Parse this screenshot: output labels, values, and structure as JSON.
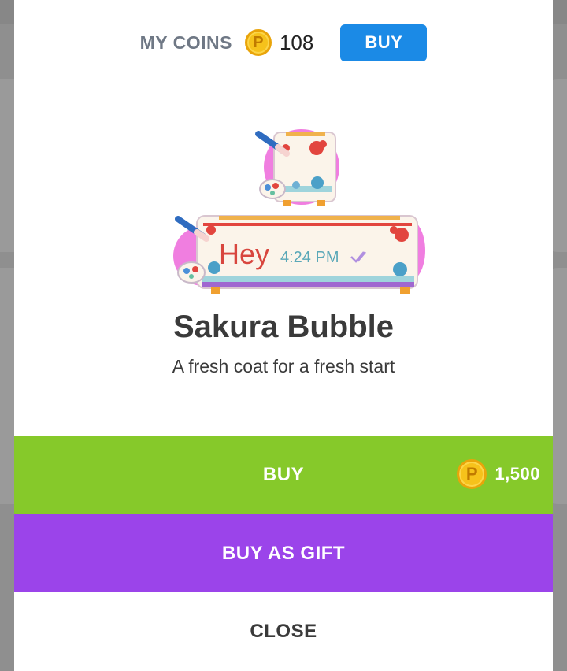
{
  "header": {
    "coins_label": "MY COINS",
    "coin_symbol": "P",
    "coin_count": "108",
    "buy_label": "BUY"
  },
  "preview": {
    "bubble_text": "Hey",
    "bubble_time": "4:24 PM"
  },
  "item": {
    "title": "Sakura Bubble",
    "subtitle": "A fresh coat for a fresh start"
  },
  "actions": {
    "buy_label": "BUY",
    "price": "1,500",
    "gift_label": "BUY AS GIFT",
    "close_label": "CLOSE"
  },
  "colors": {
    "buy_green": "#86c92a",
    "gift_purple": "#9b44ea",
    "accent_blue": "#1b8ae6",
    "coin_gold": "#f6c21b"
  }
}
